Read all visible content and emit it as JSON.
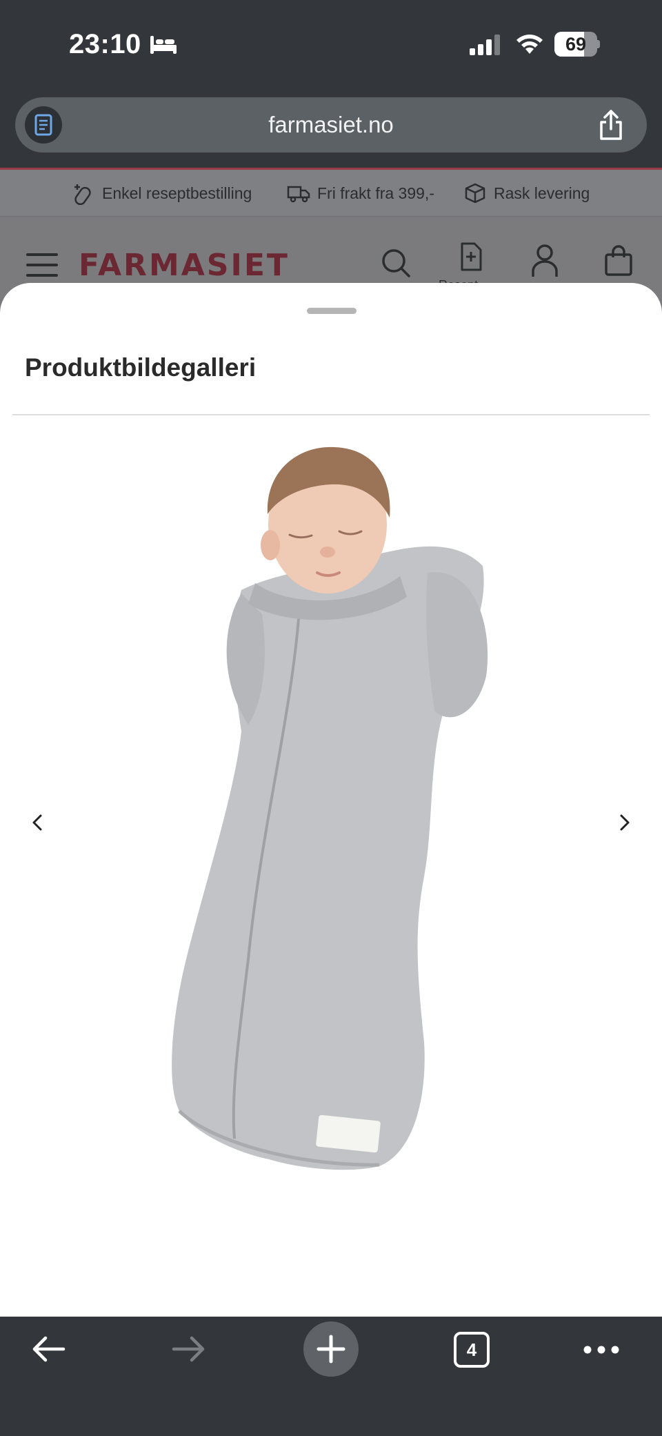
{
  "status": {
    "time": "23:10",
    "battery": "69",
    "battery_level": 0.69
  },
  "browser": {
    "url": "farmasiet.no",
    "tabs_count": "4"
  },
  "site": {
    "usps": [
      "Enkel reseptbestilling",
      "Fri frakt fra 399,-",
      "Rask levering"
    ],
    "logo": "FARMASIET",
    "prescription_label": "Resept"
  },
  "gallery": {
    "title": "Produktbildegalleri"
  },
  "colors": {
    "brand": "#9b3b47",
    "chrome": "#33363a",
    "sheet": "#ffffff"
  }
}
